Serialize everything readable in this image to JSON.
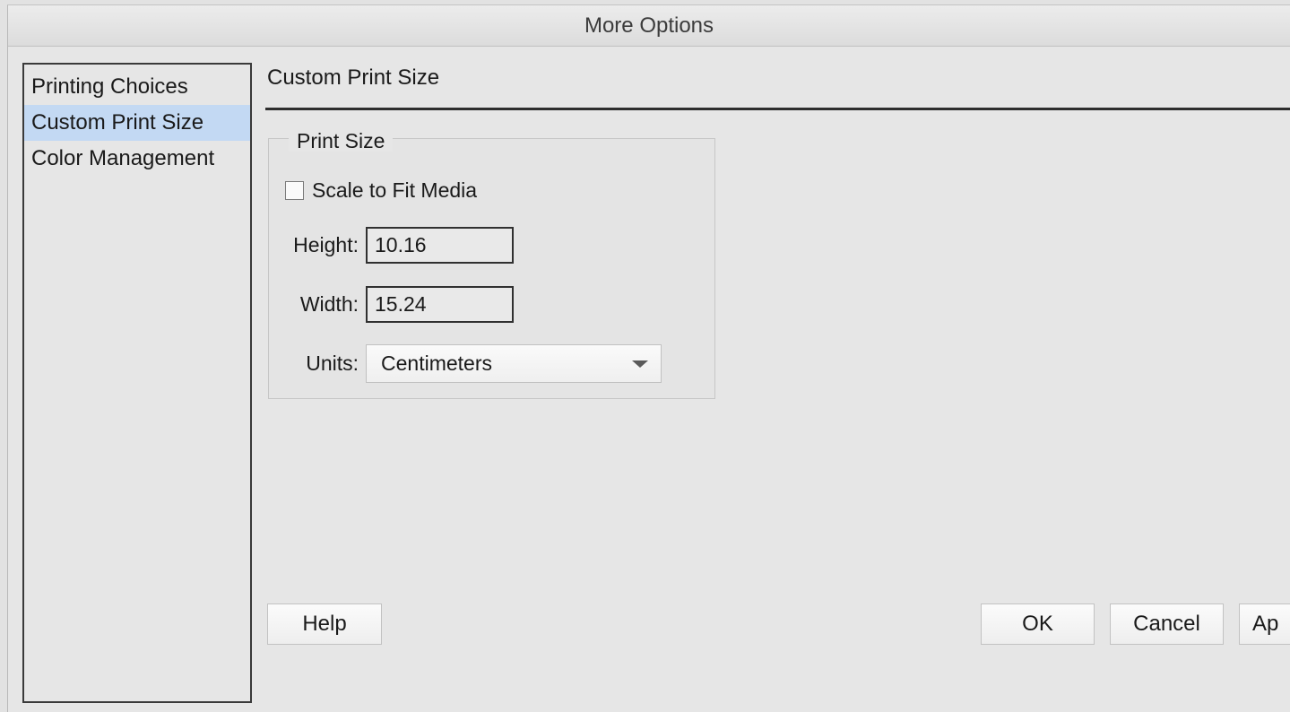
{
  "window": {
    "title": "More Options"
  },
  "sidebar": {
    "items": [
      {
        "label": "Printing Choices",
        "selected": false
      },
      {
        "label": "Custom Print Size",
        "selected": true
      },
      {
        "label": "Color Management",
        "selected": false
      }
    ]
  },
  "main": {
    "section_title": "Custom Print Size",
    "print_size": {
      "legend": "Print Size",
      "scale_to_fit": {
        "label": "Scale to Fit Media",
        "checked": false
      },
      "height": {
        "label": "Height:",
        "value": "10.16"
      },
      "width": {
        "label": "Width:",
        "value": "15.24"
      },
      "units": {
        "label": "Units:",
        "selected": "Centimeters"
      }
    }
  },
  "buttons": {
    "help": "Help",
    "ok": "OK",
    "cancel": "Cancel",
    "apply_partial": "Ap"
  },
  "colors": {
    "selection": "#c3d9f3",
    "window_background": "#e6e6e6"
  }
}
